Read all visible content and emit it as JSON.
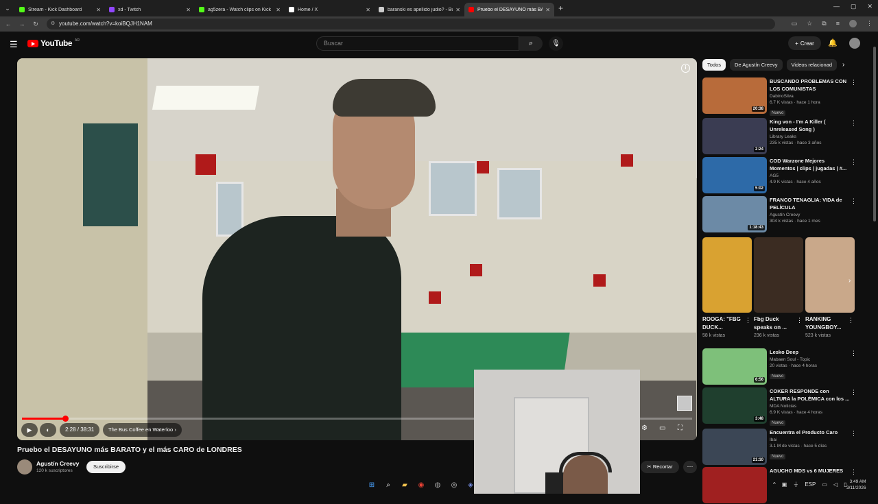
{
  "browser": {
    "tabs": [
      {
        "label": "Stream - Kick Dashboard",
        "color": "#53fc18"
      },
      {
        "label": "xd - Twitch",
        "color": "#9146ff"
      },
      {
        "label": "ag5zera - Watch clips on Kick",
        "color": "#53fc18"
      },
      {
        "label": "Home / X",
        "color": "#ffffff"
      },
      {
        "label": "baranski es apellido judio? - Bu",
        "color": "#cccccc"
      },
      {
        "label": "Pruebo el DESAYUNO más BAR",
        "color": "#ff0000"
      }
    ],
    "url": "youtube.com/watch?v=koiBQJH1NAM"
  },
  "header": {
    "logo_text": "YouTube",
    "region": "AR",
    "search_placeholder": "Buscar",
    "create_label": "Crear"
  },
  "player": {
    "time": "2:28 / 38:31",
    "chapter": "The Bus Coffee en Waterloo",
    "progress_fraction": 0.064
  },
  "video": {
    "title": "Pruebo el DESAYUNO más BARATO y el más CARO de LONDRES",
    "channel": "Agustín Creevy",
    "subscribers": "120 k suscriptores",
    "subscribe_label": "Suscribirse",
    "clip_label": "Recortar"
  },
  "chips": [
    "Todos",
    "De Agustín Creevy",
    "Videos relacionad"
  ],
  "recommendations": [
    {
      "title": "BUSCANDO PROBLEMAS CON LOS COMUNISTAS",
      "channel": "DabinoSilva",
      "meta": "6.7 K vistas · hace 1 hora",
      "duration": "20:38",
      "badge": "Nuevo",
      "color": "#b86b3a"
    },
    {
      "title": "King von - I'm A Killer ( Unreleased Song )",
      "channel": "Library Leaks",
      "meta": "235 k vistas · hace 3 años",
      "duration": "2:24",
      "badge": "",
      "color": "#3a3c52"
    },
    {
      "title": "COD Warzone Mejores Momentos | clips | jugadas | #...",
      "channel": "AG5",
      "meta": "4.9 K vistas · hace 4 años",
      "duration": "5:02",
      "badge": "",
      "color": "#2d6aa8"
    },
    {
      "title": "FRANCO TENAGLIA: VIDA de PELÍCULA",
      "channel": "Agustín Creevy",
      "meta": "304 k vistas · hace 1 mes",
      "duration": "1:18:43",
      "badge": "",
      "color": "#6c8aa6"
    }
  ],
  "shorts": [
    {
      "title": "ROOGA: \"FBG DUCK...",
      "views": "58 k vistas",
      "color": "#d9a231"
    },
    {
      "title": "Fbg Duck speaks on ...",
      "views": "236 k vistas",
      "color": "#3b2c22"
    },
    {
      "title": "RANKING YOUNGBOY...",
      "views": "523 k vistas",
      "color": "#c9a88a"
    }
  ],
  "recommendations2": [
    {
      "title": "Lesko Deep",
      "channel": "Mabaen Soul - Topic",
      "meta": "20 vistas · hace 4 horas",
      "duration": "6:56",
      "badge": "Nuevo",
      "color": "#7ec07a"
    },
    {
      "title": "COKER RESPONDE con ALTURA la POLÉMICA con los ...",
      "channel": "MDA Noticias",
      "meta": "6.9 K vistas · hace 4 horas",
      "duration": "3:48",
      "badge": "Nuevo",
      "color": "#1f3f2e"
    },
    {
      "title": "Encuentra el Producto Caro",
      "channel": "Ibai",
      "meta": "3.1 M de vistas · hace 5 días",
      "duration": "21:10",
      "badge": "Nuevo",
      "color": "#3b4655"
    },
    {
      "title": "AGUCHO MDS vs 6 MUJERES",
      "channel": "",
      "meta": "",
      "duration": "",
      "badge": "",
      "color": "#a02020"
    }
  ],
  "taskbar": {
    "lang": "ESP",
    "time": "3:49 AM",
    "date": "3/11/2026"
  }
}
